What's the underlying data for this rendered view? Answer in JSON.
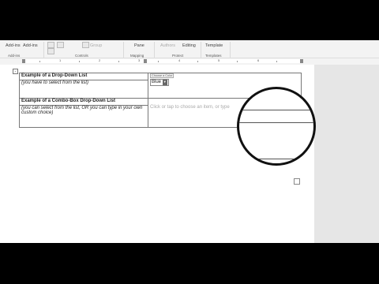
{
  "ribbon": {
    "addins_buttons": [
      "Add-ins",
      "Add-ins"
    ],
    "group_addins": "Add-ins",
    "controls_dim": "Group",
    "group_controls": "Controls",
    "mapping_button": "Pane",
    "group_mapping": "Mapping",
    "protect_dim": "Authors",
    "protect_button": "Editing",
    "group_protect": "Protect",
    "templates_button": "Template",
    "group_templates": "Templates"
  },
  "ruler": {
    "numbers": [
      "1",
      "2",
      "3",
      "4",
      "5",
      "6"
    ]
  },
  "document": {
    "anchor_glyph": "+",
    "row1_title": "Example of a Drop-Down List",
    "row1_note": "(you have to select from the list)",
    "dropdown_tag": "Choose a Color",
    "dropdown_value": "Blue",
    "dropdown_arrow": "▼",
    "row2_title": "Example of a Combo-Box Drop-Down List",
    "row2_note": "(you can select from the list, OR you can type in your own custom choice)",
    "combo_placeholder": "Click or tap to choose an item, or type"
  }
}
